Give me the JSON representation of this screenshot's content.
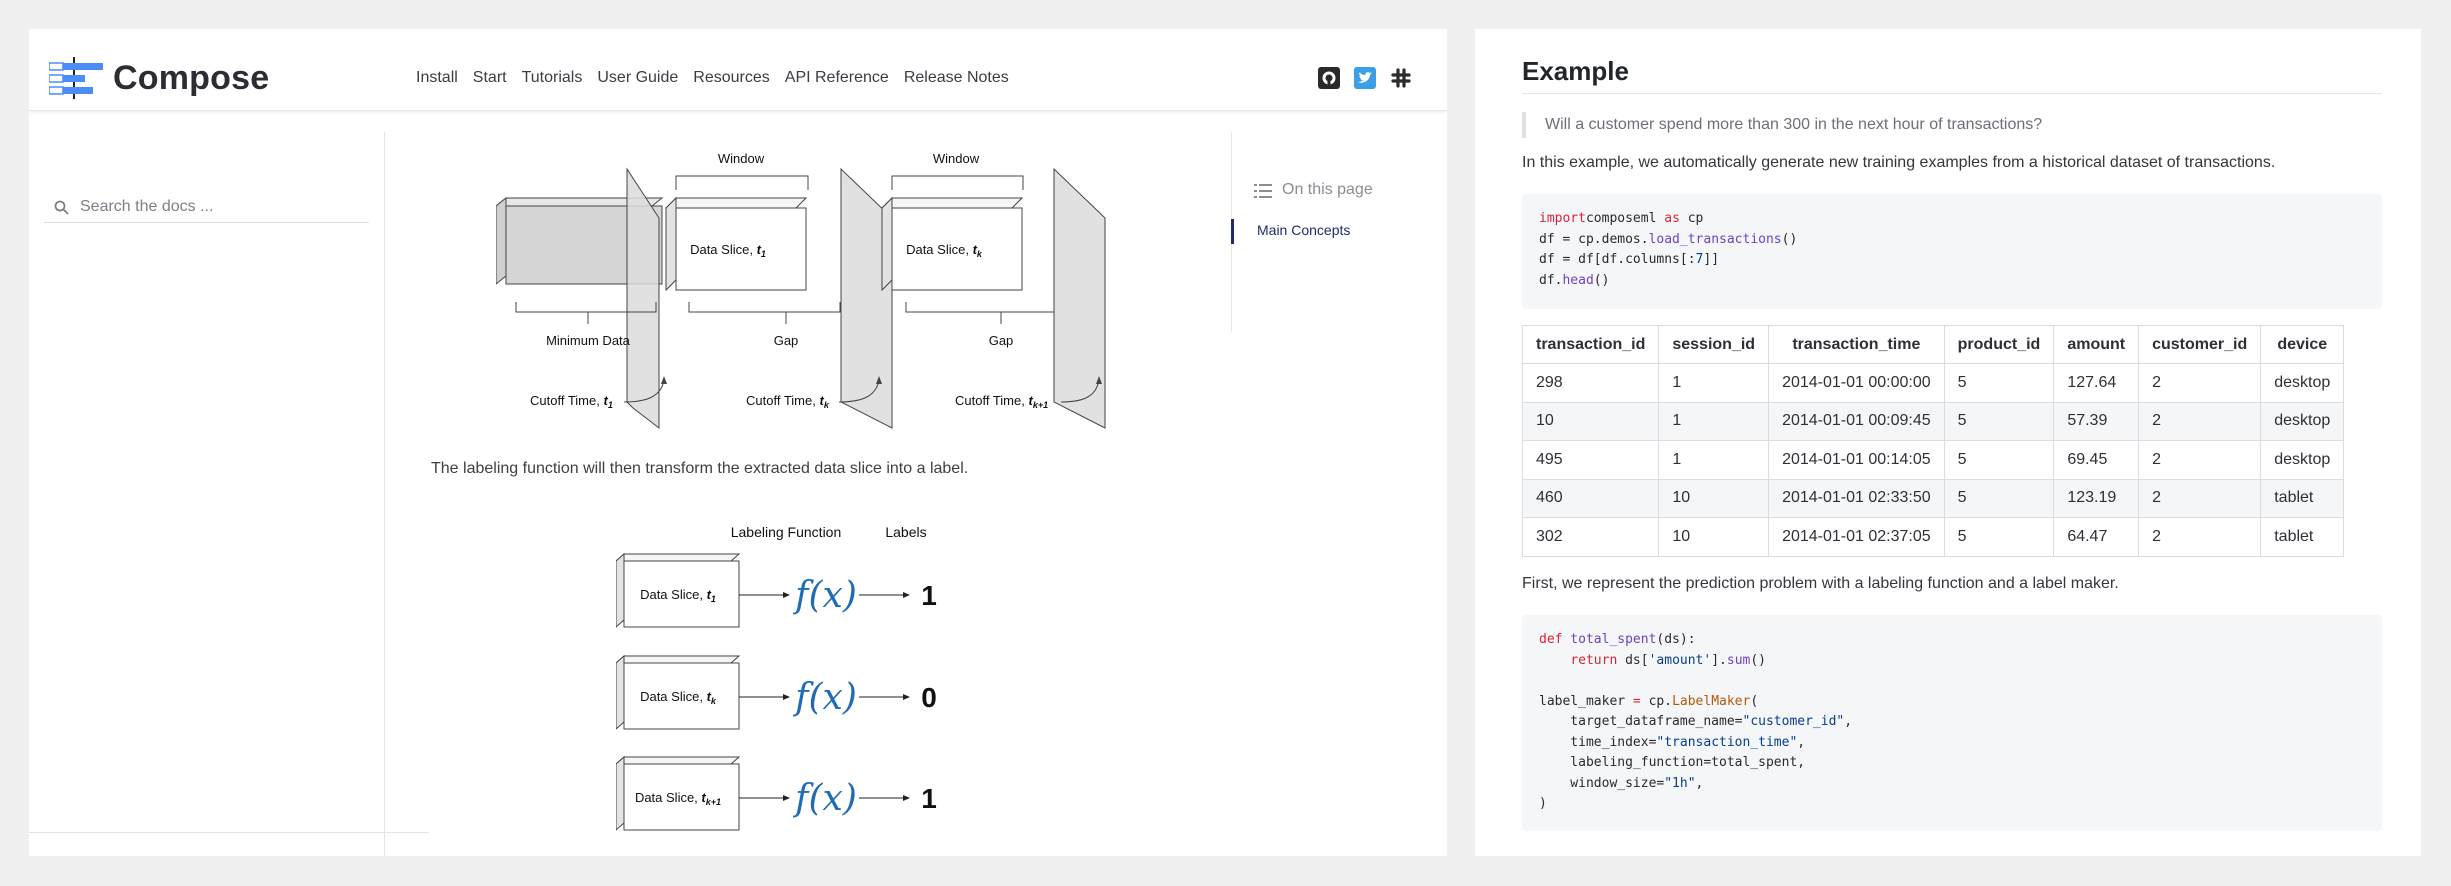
{
  "left": {
    "brand": "Compose",
    "nav": [
      "Install",
      "Start",
      "Tutorials",
      "User Guide",
      "Resources",
      "API Reference",
      "Release Notes"
    ],
    "social_icons": [
      "github-icon",
      "twitter-icon",
      "slack-icon"
    ],
    "search_placeholder": "Search the docs ...",
    "toc": {
      "title": "On this page",
      "items": [
        "Main Concepts"
      ]
    },
    "diagram1": {
      "window_label": "Window",
      "data_slice": "Data Slice, ",
      "minimum_data": "Minimum Data",
      "gap": "Gap",
      "cutoff_time": "Cutoff Time, ",
      "sub_1": "1",
      "sub_k": "k",
      "sub_k1": "k+1",
      "t": "t"
    },
    "caption": "The labeling function will then transform the extracted data slice into a label.",
    "diagram2": {
      "labeling_function": "Labeling Function",
      "labels": "Labels",
      "rows": [
        {
          "slice": "Data Slice, ",
          "sub": "1",
          "label": "1"
        },
        {
          "slice": "Data Slice, ",
          "sub": "k",
          "label": "0"
        },
        {
          "slice": "Data Slice, ",
          "sub": "k+1",
          "label": "1"
        }
      ],
      "fx": "f(x)"
    }
  },
  "right": {
    "heading": "Example",
    "quote": "Will a customer spend more than 300 in the next hour of transactions?",
    "intro": "In this example, we automatically generate new training examples from a historical dataset of transactions.",
    "code1": [
      [
        [
          "kw",
          "import"
        ],
        [
          "",
          "composeml "
        ],
        [
          "kw",
          "as"
        ],
        [
          "",
          " cp"
        ]
      ],
      [
        [
          "",
          "df = cp.demos."
        ],
        [
          "fn",
          "load_transactions"
        ],
        [
          "",
          "()"
        ]
      ],
      [
        [
          "",
          "df = df[df.columns[:"
        ],
        [
          "str",
          "7"
        ],
        [
          "",
          "]]"
        ]
      ],
      [
        [
          "",
          "df."
        ],
        [
          "fn",
          "head"
        ],
        [
          "",
          "()"
        ]
      ]
    ],
    "table": {
      "columns": [
        "transaction_id",
        "session_id",
        "transaction_time",
        "product_id",
        "amount",
        "customer_id",
        "device"
      ],
      "rows": [
        [
          "298",
          "1",
          "2014-01-01 00:00:00",
          "5",
          "127.64",
          "2",
          "desktop"
        ],
        [
          "10",
          "1",
          "2014-01-01 00:09:45",
          "5",
          "57.39",
          "2",
          "desktop"
        ],
        [
          "495",
          "1",
          "2014-01-01 00:14:05",
          "5",
          "69.45",
          "2",
          "desktop"
        ],
        [
          "460",
          "10",
          "2014-01-01 02:33:50",
          "5",
          "123.19",
          "2",
          "tablet"
        ],
        [
          "302",
          "10",
          "2014-01-01 02:37:05",
          "5",
          "64.47",
          "2",
          "tablet"
        ]
      ]
    },
    "para2": "First, we represent the prediction problem with a labeling function and a label maker.",
    "code2": [
      [
        [
          "kw",
          "def"
        ],
        [
          "",
          ""
        ],
        [
          "fn",
          " total_spent"
        ],
        [
          "",
          "(ds):"
        ]
      ],
      [
        [
          "",
          "    "
        ],
        [
          "kw",
          "return"
        ],
        [
          "",
          " ds["
        ],
        [
          "str",
          "'amount'"
        ],
        [
          "",
          "]."
        ],
        [
          "fn",
          "sum"
        ],
        [
          "",
          "()"
        ]
      ],
      [
        [
          "",
          ""
        ]
      ],
      [
        [
          "",
          "label_maker "
        ],
        [
          "op",
          "="
        ],
        [
          "",
          " cp."
        ],
        [
          "cls",
          "LabelMaker"
        ],
        [
          "",
          "("
        ]
      ],
      [
        [
          "",
          "    target_dataframe_name="
        ],
        [
          "str",
          "\"customer_id\""
        ],
        [
          "",
          ","
        ]
      ],
      [
        [
          "",
          "    time_index="
        ],
        [
          "str",
          "\"transaction_time\""
        ],
        [
          "",
          ","
        ]
      ],
      [
        [
          "",
          "    labeling_function=total_spent,"
        ]
      ],
      [
        [
          "",
          "    window_size="
        ],
        [
          "str",
          "\"1h\""
        ],
        [
          "",
          ","
        ]
      ],
      [
        [
          "",
          ")"
        ]
      ]
    ]
  },
  "colors": {
    "accent": "#1d2b6b",
    "logo_blue": "#4a8df8",
    "fx_blue": "#1f6bb5",
    "keyword_red": "#d8243a",
    "function_purple": "#6f42c1",
    "string_navy": "#063e8f"
  }
}
